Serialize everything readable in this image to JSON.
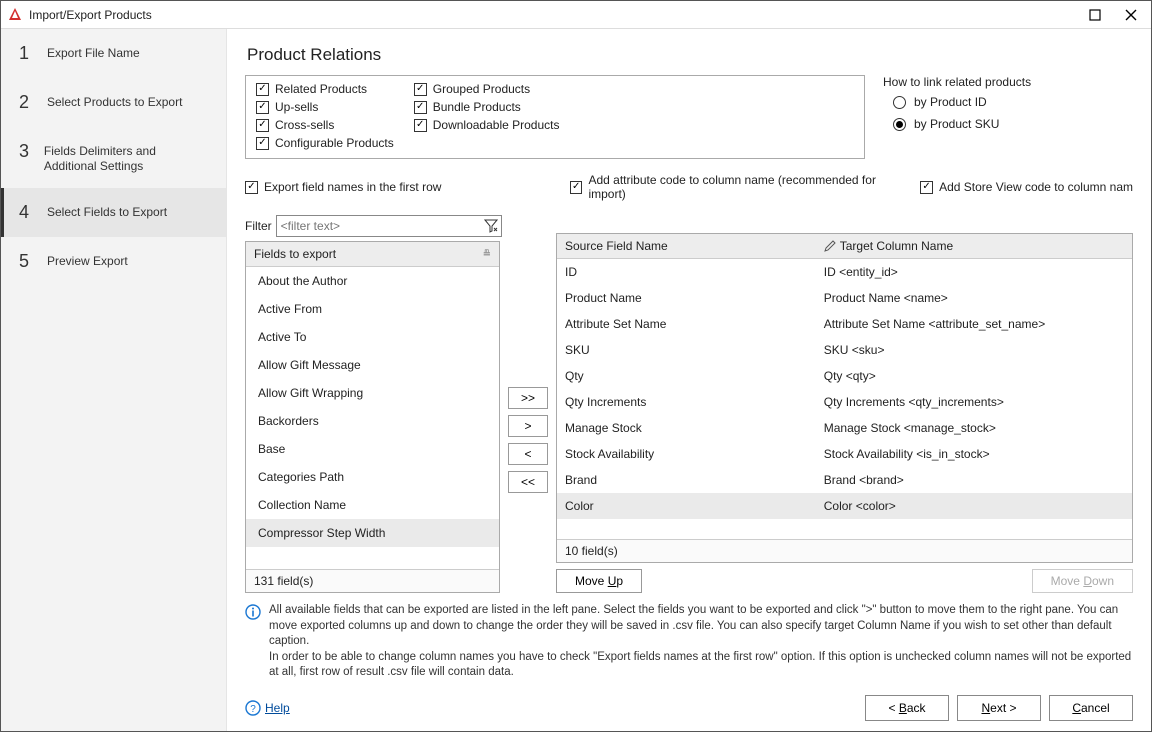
{
  "window": {
    "title": "Import/Export Products"
  },
  "steps": [
    {
      "num": "1",
      "label": "Export File Name"
    },
    {
      "num": "2",
      "label": "Select Products to Export"
    },
    {
      "num": "3",
      "label": "Fields Delimiters and Additional Settings"
    },
    {
      "num": "4",
      "label": "Select Fields to Export"
    },
    {
      "num": "5",
      "label": "Preview Export"
    }
  ],
  "active_step": 3,
  "section_title": "Product Relations",
  "relations": {
    "col1": [
      "Related Products",
      "Up-sells",
      "Cross-sells",
      "Configurable Products"
    ],
    "col2": [
      "Grouped Products",
      "Bundle Products",
      "Downloadable Products"
    ]
  },
  "link_group": {
    "title": "How to link related products",
    "options": [
      "by Product ID",
      "by Product SKU"
    ],
    "selected": 1
  },
  "options": {
    "export_first_row": "Export field names in the first row",
    "add_attr_code": "Add attribute code to column name (recommended for import)",
    "add_store_view": "Add Store View code to column nam"
  },
  "filter": {
    "label": "Filter",
    "placeholder": "<filter text>"
  },
  "fields_header": "Fields to export",
  "fields": [
    "About the Author",
    "Active From",
    "Active To",
    "Allow Gift Message",
    "Allow Gift Wrapping",
    "Backorders",
    "Base",
    "Categories Path",
    "Collection Name",
    "Compressor Step Width"
  ],
  "fields_selected": 9,
  "fields_count": "131 field(s)",
  "mid_buttons": [
    ">>",
    ">",
    "<",
    "<<"
  ],
  "columns": {
    "src_header": "Source Field Name",
    "tgt_header": "Target Column Name",
    "rows": [
      {
        "src": "ID",
        "tgt": "ID <entity_id>"
      },
      {
        "src": "Product Name",
        "tgt": "Product Name <name>"
      },
      {
        "src": "Attribute Set Name",
        "tgt": "Attribute Set Name <attribute_set_name>"
      },
      {
        "src": "SKU",
        "tgt": "SKU <sku>"
      },
      {
        "src": "Qty",
        "tgt": "Qty <qty>"
      },
      {
        "src": "Qty Increments",
        "tgt": "Qty Increments <qty_increments>"
      },
      {
        "src": "Manage Stock",
        "tgt": "Manage Stock <manage_stock>"
      },
      {
        "src": "Stock Availability",
        "tgt": "Stock Availability <is_in_stock>"
      },
      {
        "src": "Brand",
        "tgt": "Brand <brand>"
      },
      {
        "src": "Color",
        "tgt": "Color <color>"
      }
    ],
    "selected": 9,
    "count": "10 field(s)"
  },
  "move": {
    "up": "Move Up",
    "down": "Move Down"
  },
  "info": "All available fields that can be exported are listed in the left pane. Select the fields you want to be exported and click \">\" button to move them to the right pane. You can move exported columns up and down to change the order they will be saved in .csv file. You can also specify target Column Name if you wish to set other than default caption.\nIn order to be able to change column names you have to check \"Export fields names at the first row\" option. If this option is unchecked column names will not be exported at all, first row of result .csv file will contain data.",
  "help": "Help",
  "nav": {
    "back": "< Back",
    "next": "Next >",
    "cancel": "Cancel"
  }
}
